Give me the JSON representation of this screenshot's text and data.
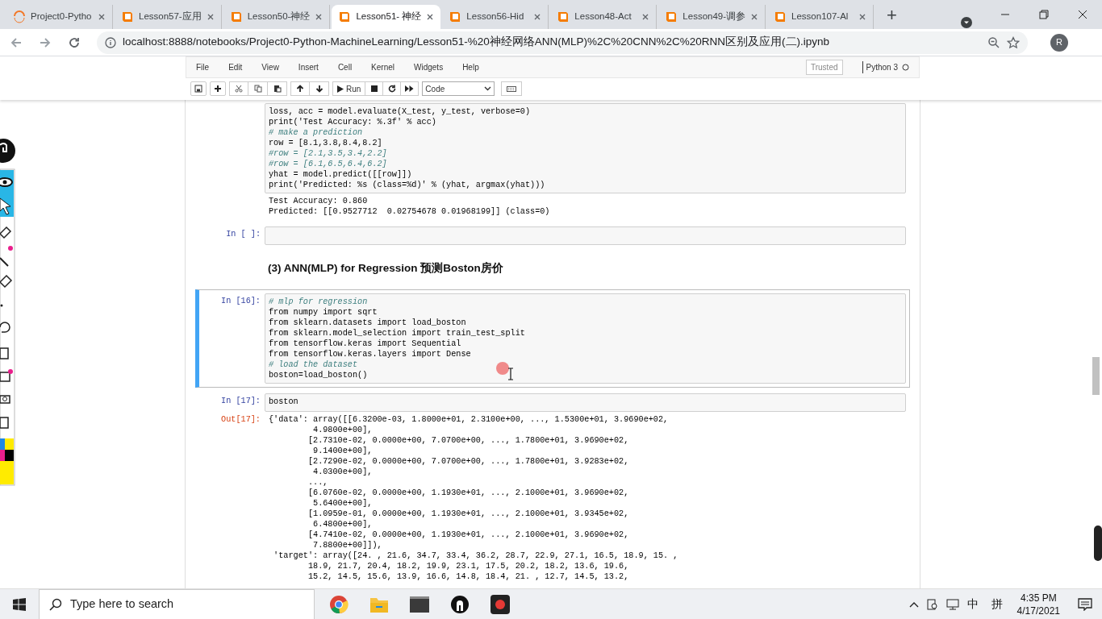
{
  "browser": {
    "tabs": [
      {
        "label": "Project0-Pytho",
        "kind": "jupyter",
        "selected": false
      },
      {
        "label": "Lesson57-应用",
        "kind": "notebook",
        "selected": false
      },
      {
        "label": "Lesson50-神经",
        "kind": "notebook",
        "selected": false
      },
      {
        "label": "Lesson51- 神经",
        "kind": "notebook",
        "selected": true
      },
      {
        "label": "Lesson56-Hid",
        "kind": "notebook",
        "selected": false
      },
      {
        "label": "Lesson48-Act",
        "kind": "notebook",
        "selected": false
      },
      {
        "label": "Lesson49-调参",
        "kind": "notebook",
        "selected": false
      },
      {
        "label": "Lesson107-Al",
        "kind": "notebook",
        "selected": false
      }
    ],
    "new_tab": "+",
    "url": "localhost:8888/notebooks/Project0-Python-MachineLearning/Lesson51-%20神经网络ANN(MLP)%2C%20CNN%2C%20RNN区别及应用(二).ipynb",
    "profile": "R"
  },
  "menu": [
    "File",
    "Edit",
    "View",
    "Insert",
    "Cell",
    "Kernel",
    "Widgets",
    "Help"
  ],
  "trusted": "Trusted",
  "kernel": "Python 3",
  "toolbar": {
    "run": "Run",
    "cell_type": "Code"
  },
  "cells": [
    {
      "kind": "code",
      "selected": false,
      "lines": [
        {
          "kind": "code",
          "text": "loss, acc = model.evaluate(X_test, y_test, verbose=0)"
        },
        {
          "kind": "code",
          "text": "print('Test Accuracy: %.3f' % acc)"
        },
        {
          "kind": "comment",
          "text": "# make a prediction"
        },
        {
          "kind": "code",
          "text": "row = [8.1,3.8,8.4,8.2]"
        },
        {
          "kind": "comment",
          "text": "#row = [2.1,3.5,3.4,2.2]"
        },
        {
          "kind": "comment",
          "text": "#row = [6.1,6.5,6.4,6.2]"
        },
        {
          "kind": "code",
          "text": "yhat = model.predict([[row]])"
        },
        {
          "kind": "code",
          "text": "print('Predicted: %s (class=%d)' % (yhat, argmax(yhat)))"
        }
      ],
      "output": {
        "lines": [
          "Test Accuracy: 0.860",
          "Predicted: [[0.9527712  0.02754678 0.01968199]] (class=0)"
        ]
      }
    },
    {
      "kind": "code",
      "prompt": "In [ ]:",
      "selected": false
    },
    {
      "kind": "markdown",
      "heading": "(3) ANN(MLP) for Regression 预测Boston房价"
    },
    {
      "kind": "code",
      "prompt": "In [16]:",
      "selected": true,
      "lines": [
        {
          "kind": "comment",
          "text": "# mlp for regression"
        },
        {
          "kind": "code",
          "text": "from numpy import sqrt"
        },
        {
          "kind": "code",
          "text": "from sklearn.datasets import load_boston"
        },
        {
          "kind": "code",
          "text": "from sklearn.model_selection import train_test_split"
        },
        {
          "kind": "code",
          "text": "from tensorflow.keras import Sequential"
        },
        {
          "kind": "code",
          "text": "from tensorflow.keras.layers import Dense"
        },
        {
          "kind": "comment",
          "text": "# load the dataset"
        },
        {
          "kind": "code",
          "text": "boston=load_boston()"
        }
      ]
    },
    {
      "kind": "code",
      "prompt": "In [17]:",
      "selected": false,
      "lines": [
        {
          "kind": "code",
          "text": "boston"
        }
      ],
      "output": {
        "prompt": "Out[17]:",
        "lines": [
          "{'data': array([[6.3200e-03, 1.8000e+01, 2.3100e+00, ..., 1.5300e+01, 3.9690e+02,",
          "         4.9800e+00],",
          "        [2.7310e-02, 0.0000e+00, 7.0700e+00, ..., 1.7800e+01, 3.9690e+02,",
          "         9.1400e+00],",
          "        [2.7290e-02, 0.0000e+00, 7.0700e+00, ..., 1.7800e+01, 3.9283e+02,",
          "         4.0300e+00],",
          "        ...,",
          "        [6.0760e-02, 0.0000e+00, 1.1930e+01, ..., 2.1000e+01, 3.9690e+02,",
          "         5.6400e+00],",
          "        [1.0959e-01, 0.0000e+00, 1.1930e+01, ..., 2.1000e+01, 3.9345e+02,",
          "         6.4800e+00],",
          "        [4.7410e-02, 0.0000e+00, 1.1930e+01, ..., 2.1000e+01, 3.9690e+02,",
          "         7.8800e+00]]),",
          " 'target': array([24. , 21.6, 34.7, 33.4, 36.2, 28.7, 22.9, 27.1, 16.5, 18.9, 15. ,",
          "        18.9, 21.7, 20.4, 18.2, 19.9, 23.1, 17.5, 20.2, 18.2, 13.6, 19.6,",
          "        15.2, 14.5, 15.6, 13.9, 16.6, 14.8, 18.4, 21. , 12.7, 14.5, 13.2,"
        ]
      }
    }
  ],
  "taskbar": {
    "search_placeholder": "Type here to search",
    "ime": "中",
    "ime_mode": "拼",
    "time": "4:35 PM",
    "date": "4/17/2021"
  }
}
